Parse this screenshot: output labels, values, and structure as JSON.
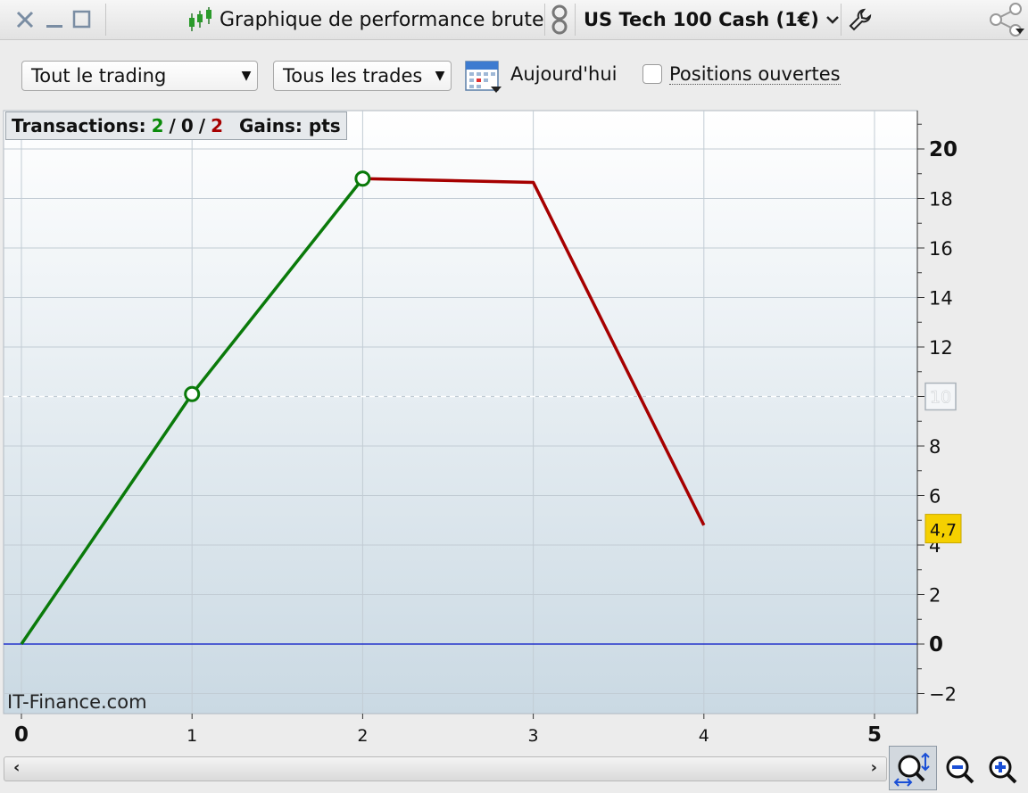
{
  "window": {
    "title": "Graphique de performance brute",
    "instrument": "US Tech 100 Cash (1€)"
  },
  "toolbar": {
    "scope_select": "Tout le trading",
    "trades_select": "Tous les trades",
    "today_label": "Aujourd'hui",
    "open_positions_label": "Positions ouvertes",
    "open_positions_checked": false
  },
  "stats": {
    "transactions_label": "Transactions:",
    "wins": "2",
    "sep1": "/",
    "neutral": "0",
    "sep2": "/",
    "losses": "2",
    "gains_label": "Gains: pts"
  },
  "colors": {
    "gain": "#0a7a0a",
    "loss": "#a60000",
    "zero_line": "#2233cc",
    "current_badge": "#f5d000"
  },
  "chart_data": {
    "type": "line",
    "x": [
      0,
      1,
      2,
      3,
      4
    ],
    "series": [
      {
        "values": [
          0,
          10.1,
          18.8
        ],
        "x": [
          0,
          1,
          2
        ],
        "color": "gain"
      },
      {
        "values": [
          18.8,
          18.65,
          4.8
        ],
        "x": [
          2,
          3,
          4
        ],
        "color": "loss"
      }
    ],
    "markers": [
      {
        "x": 1,
        "y": 10.1
      },
      {
        "x": 2,
        "y": 18.8
      }
    ],
    "xlim": [
      0,
      5
    ],
    "ylim": [
      -2,
      20
    ],
    "x_ticks": [
      "0",
      "1",
      "2",
      "3",
      "4",
      "5"
    ],
    "y_ticks": [
      "-2",
      "0",
      "2",
      "4",
      "6",
      "8",
      "10",
      "12",
      "14",
      "16",
      "18",
      "20"
    ],
    "reference_level": 10,
    "reference_label": "10",
    "current_value_label": "4,7",
    "current_value": 4.7,
    "watermark": "IT-Finance.com",
    "grid": true
  }
}
